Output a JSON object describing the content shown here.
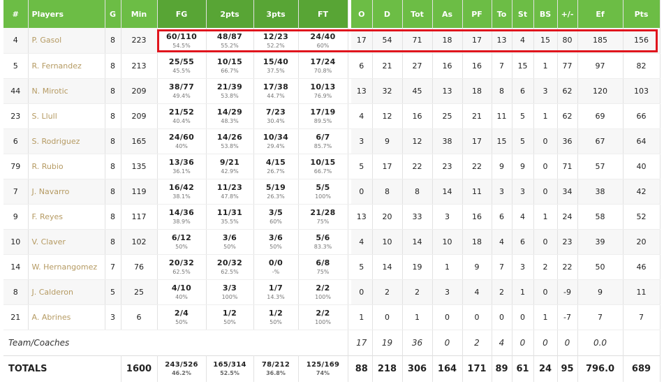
{
  "headers": {
    "num": "#",
    "players": "Players",
    "g": "G",
    "min": "Min",
    "fg": "FG",
    "pts2": "2pts",
    "pts3": "3pts",
    "ft": "FT",
    "o": "O",
    "d": "D",
    "tot": "Tot",
    "as": "As",
    "pf": "PF",
    "to": "To",
    "st": "St",
    "bs": "BS",
    "pm": "+/-",
    "ef": "Ef",
    "pts": "Pts"
  },
  "players": [
    {
      "num": "4",
      "name": "P. Gasol",
      "g": "8",
      "min": "223",
      "fg": "60/110",
      "fg_pct": "54.5%",
      "p2": "48/87",
      "p2_pct": "55.2%",
      "p3": "12/23",
      "p3_pct": "52.2%",
      "ft": "24/40",
      "ft_pct": "60%",
      "o": "17",
      "d": "54",
      "tot": "71",
      "as": "18",
      "pf": "17",
      "to": "13",
      "st": "4",
      "bs": "15",
      "pm": "80",
      "ef": "185",
      "pts": "156"
    },
    {
      "num": "5",
      "name": "R. Fernandez",
      "g": "8",
      "min": "213",
      "fg": "25/55",
      "fg_pct": "45.5%",
      "p2": "10/15",
      "p2_pct": "66.7%",
      "p3": "15/40",
      "p3_pct": "37.5%",
      "ft": "17/24",
      "ft_pct": "70.8%",
      "o": "6",
      "d": "21",
      "tot": "27",
      "as": "16",
      "pf": "16",
      "to": "7",
      "st": "15",
      "bs": "1",
      "pm": "77",
      "ef": "97",
      "pts": "82"
    },
    {
      "num": "44",
      "name": "N. Mirotic",
      "g": "8",
      "min": "209",
      "fg": "38/77",
      "fg_pct": "49.4%",
      "p2": "21/39",
      "p2_pct": "53.8%",
      "p3": "17/38",
      "p3_pct": "44.7%",
      "ft": "10/13",
      "ft_pct": "76.9%",
      "o": "13",
      "d": "32",
      "tot": "45",
      "as": "13",
      "pf": "18",
      "to": "8",
      "st": "6",
      "bs": "3",
      "pm": "62",
      "ef": "120",
      "pts": "103"
    },
    {
      "num": "23",
      "name": "S. Llull",
      "g": "8",
      "min": "209",
      "fg": "21/52",
      "fg_pct": "40.4%",
      "p2": "14/29",
      "p2_pct": "48.3%",
      "p3": "7/23",
      "p3_pct": "30.4%",
      "ft": "17/19",
      "ft_pct": "89.5%",
      "o": "4",
      "d": "12",
      "tot": "16",
      "as": "25",
      "pf": "21",
      "to": "11",
      "st": "5",
      "bs": "1",
      "pm": "62",
      "ef": "69",
      "pts": "66"
    },
    {
      "num": "6",
      "name": "S. Rodriguez",
      "g": "8",
      "min": "165",
      "fg": "24/60",
      "fg_pct": "40%",
      "p2": "14/26",
      "p2_pct": "53.8%",
      "p3": "10/34",
      "p3_pct": "29.4%",
      "ft": "6/7",
      "ft_pct": "85.7%",
      "o": "3",
      "d": "9",
      "tot": "12",
      "as": "38",
      "pf": "17",
      "to": "15",
      "st": "5",
      "bs": "0",
      "pm": "36",
      "ef": "67",
      "pts": "64"
    },
    {
      "num": "79",
      "name": "R. Rubio",
      "g": "8",
      "min": "135",
      "fg": "13/36",
      "fg_pct": "36.1%",
      "p2": "9/21",
      "p2_pct": "42.9%",
      "p3": "4/15",
      "p3_pct": "26.7%",
      "ft": "10/15",
      "ft_pct": "66.7%",
      "o": "5",
      "d": "17",
      "tot": "22",
      "as": "23",
      "pf": "22",
      "to": "9",
      "st": "9",
      "bs": "0",
      "pm": "71",
      "ef": "57",
      "pts": "40"
    },
    {
      "num": "7",
      "name": "J. Navarro",
      "g": "8",
      "min": "119",
      "fg": "16/42",
      "fg_pct": "38.1%",
      "p2": "11/23",
      "p2_pct": "47.8%",
      "p3": "5/19",
      "p3_pct": "26.3%",
      "ft": "5/5",
      "ft_pct": "100%",
      "o": "0",
      "d": "8",
      "tot": "8",
      "as": "14",
      "pf": "11",
      "to": "3",
      "st": "3",
      "bs": "0",
      "pm": "34",
      "ef": "38",
      "pts": "42"
    },
    {
      "num": "9",
      "name": "F. Reyes",
      "g": "8",
      "min": "117",
      "fg": "14/36",
      "fg_pct": "38.9%",
      "p2": "11/31",
      "p2_pct": "35.5%",
      "p3": "3/5",
      "p3_pct": "60%",
      "ft": "21/28",
      "ft_pct": "75%",
      "o": "13",
      "d": "20",
      "tot": "33",
      "as": "3",
      "pf": "16",
      "to": "6",
      "st": "4",
      "bs": "1",
      "pm": "24",
      "ef": "58",
      "pts": "52"
    },
    {
      "num": "10",
      "name": "V. Claver",
      "g": "8",
      "min": "102",
      "fg": "6/12",
      "fg_pct": "50%",
      "p2": "3/6",
      "p2_pct": "50%",
      "p3": "3/6",
      "p3_pct": "50%",
      "ft": "5/6",
      "ft_pct": "83.3%",
      "o": "4",
      "d": "10",
      "tot": "14",
      "as": "10",
      "pf": "18",
      "to": "4",
      "st": "6",
      "bs": "0",
      "pm": "23",
      "ef": "39",
      "pts": "20"
    },
    {
      "num": "14",
      "name": "W. Hernangomez",
      "g": "7",
      "min": "76",
      "fg": "20/32",
      "fg_pct": "62.5%",
      "p2": "20/32",
      "p2_pct": "62.5%",
      "p3": "0/0",
      "p3_pct": "-%",
      "ft": "6/8",
      "ft_pct": "75%",
      "o": "5",
      "d": "14",
      "tot": "19",
      "as": "1",
      "pf": "9",
      "to": "7",
      "st": "3",
      "bs": "2",
      "pm": "22",
      "ef": "50",
      "pts": "46"
    },
    {
      "num": "8",
      "name": "J. Calderon",
      "g": "5",
      "min": "25",
      "fg": "4/10",
      "fg_pct": "40%",
      "p2": "3/3",
      "p2_pct": "100%",
      "p3": "1/7",
      "p3_pct": "14.3%",
      "ft": "2/2",
      "ft_pct": "100%",
      "o": "0",
      "d": "2",
      "tot": "2",
      "as": "3",
      "pf": "4",
      "to": "2",
      "st": "1",
      "bs": "0",
      "pm": "-9",
      "ef": "9",
      "pts": "11"
    },
    {
      "num": "21",
      "name": "A. Abrines",
      "g": "3",
      "min": "6",
      "fg": "2/4",
      "fg_pct": "50%",
      "p2": "1/2",
      "p2_pct": "50%",
      "p3": "1/2",
      "p3_pct": "50%",
      "ft": "2/2",
      "ft_pct": "100%",
      "o": "1",
      "d": "0",
      "tot": "1",
      "as": "0",
      "pf": "0",
      "to": "0",
      "st": "0",
      "bs": "1",
      "pm": "-7",
      "ef": "7",
      "pts": "7"
    }
  ],
  "team": {
    "label": "Team/Coaches",
    "o": "17",
    "d": "19",
    "tot": "36",
    "as": "0",
    "pf": "2",
    "to": "4",
    "st": "0",
    "bs": "0",
    "pm": "0",
    "ef": "0.0"
  },
  "totals": {
    "label": "TOTALS",
    "min": "1600",
    "fg": "243/526",
    "fg_pct": "46.2%",
    "p2": "165/314",
    "p2_pct": "52.5%",
    "p3": "78/212",
    "p3_pct": "36.8%",
    "ft": "125/169",
    "ft_pct": "74%",
    "o": "88",
    "d": "218",
    "tot": "306",
    "as": "164",
    "pf": "171",
    "to": "89",
    "st": "61",
    "bs": "24",
    "pm": "95",
    "ef": "796.0",
    "pts": "689"
  },
  "colors": {
    "header": "#6cbd45",
    "header_shot": "#58a535",
    "highlight": "#e0151d",
    "player_name": "#b59a62"
  },
  "highlight_row": "P. Gasol"
}
